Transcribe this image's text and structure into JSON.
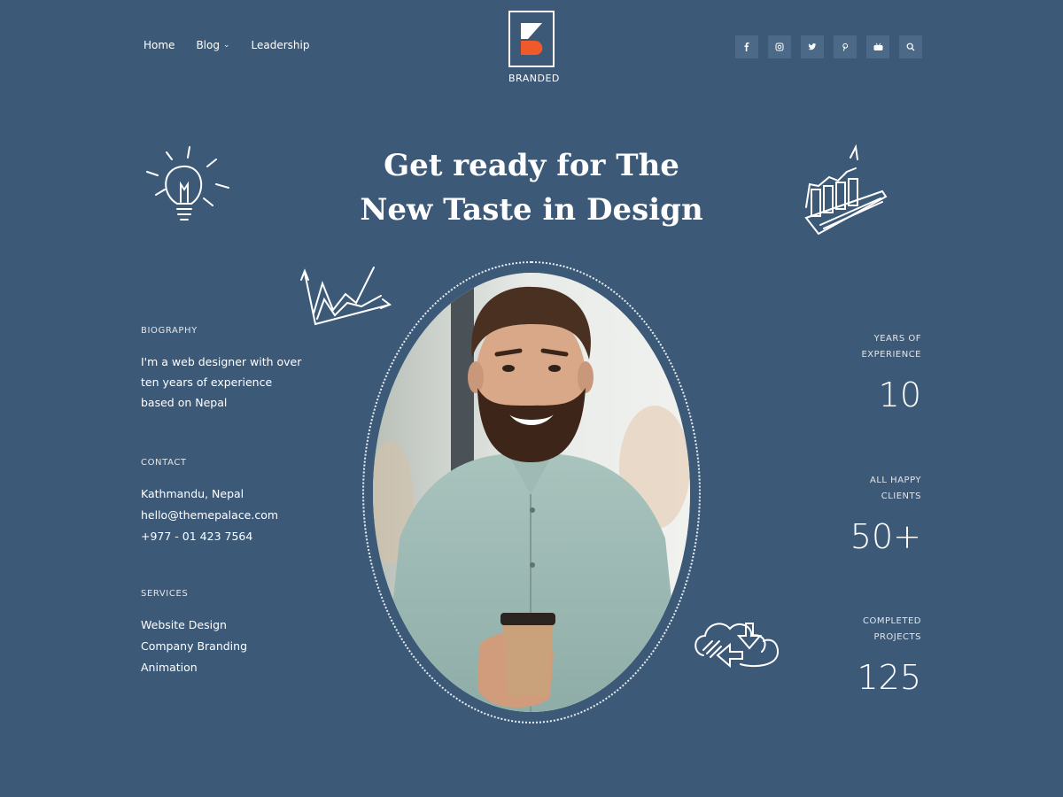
{
  "nav": {
    "items": [
      {
        "label": "Home"
      },
      {
        "label": "Blog",
        "has_dropdown": true
      },
      {
        "label": "Leadership"
      }
    ]
  },
  "logo": {
    "text": "BRANDED",
    "accent": "#f05a28"
  },
  "social": {
    "icons": [
      "facebook-icon",
      "instagram-icon",
      "twitter-icon",
      "pinterest-icon",
      "youtube-icon",
      "search-icon"
    ]
  },
  "hero": {
    "title_line1": "Get ready for The",
    "title_line2": "New Taste in Design"
  },
  "biography": {
    "label": "BIOGRAPHY",
    "line1": "I'm a web designer with over",
    "line2": "ten years of experience",
    "line3": "based on Nepal"
  },
  "contact": {
    "label": "CONTACT",
    "location": "Kathmandu, Nepal",
    "email": "hello@themepalace.com",
    "phone": "+977 - 01 423 7564"
  },
  "services": {
    "label": "SERVICES",
    "items": [
      "Website Design",
      "Company Branding",
      "Animation"
    ]
  },
  "stats": [
    {
      "label_line1": "YEARS OF",
      "label_line2": "EXPERIENCE",
      "value": "10"
    },
    {
      "label_line1": "ALL HAPPY",
      "label_line2": "CLIENTS",
      "value": "50+"
    },
    {
      "label_line1": "COMPLETED",
      "label_line2": "PROJECTS",
      "value": "125"
    }
  ],
  "colors": {
    "background": "#3c5a78",
    "social_bg": "#4c6987",
    "text": "#ffffff"
  }
}
